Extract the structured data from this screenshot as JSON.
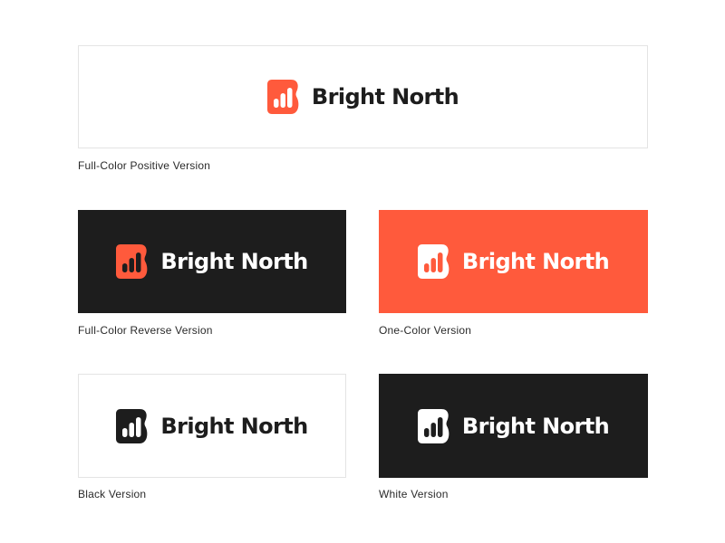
{
  "brand": {
    "name": "Bright North",
    "logo_icon": "bar-chart-b-icon"
  },
  "colors": {
    "brand_red": "#ff5a3c",
    "dark": "#1d1d1d",
    "white": "#ffffff",
    "border": "#e4e4e4"
  },
  "versions": [
    {
      "caption": "Full-Color Positive Version",
      "background": "#ffffff",
      "mark": "#ff5a3c",
      "text": "#1d1d1d"
    },
    {
      "caption": "Full-Color Reverse Version",
      "background": "#1d1d1d",
      "mark": "#ff5a3c",
      "text": "#ffffff"
    },
    {
      "caption": "One-Color Version",
      "background": "#ff5a3c",
      "mark": "#ffffff",
      "text": "#ffffff"
    },
    {
      "caption": "Black Version",
      "background": "#ffffff",
      "mark": "#1d1d1d",
      "text": "#1d1d1d"
    },
    {
      "caption": "White Version",
      "background": "#1d1d1d",
      "mark": "#ffffff",
      "text": "#ffffff"
    }
  ]
}
